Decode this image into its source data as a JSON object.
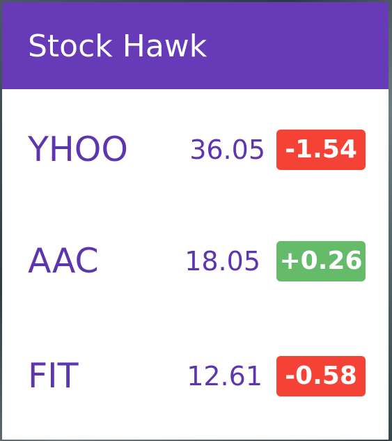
{
  "app": {
    "title": "Stock Hawk"
  },
  "colors": {
    "primary": "#673ab7",
    "text_primary": "#5e35b1",
    "negative": "#f44336",
    "positive": "#66bb6a"
  },
  "stocks": [
    {
      "symbol": "YHOO",
      "price": "36.05",
      "change": "-1.54",
      "direction": "negative"
    },
    {
      "symbol": "AAC",
      "price": "18.05",
      "change": "+0.26",
      "direction": "positive"
    },
    {
      "symbol": "FIT",
      "price": "12.61",
      "change": "-0.58",
      "direction": "negative"
    }
  ]
}
